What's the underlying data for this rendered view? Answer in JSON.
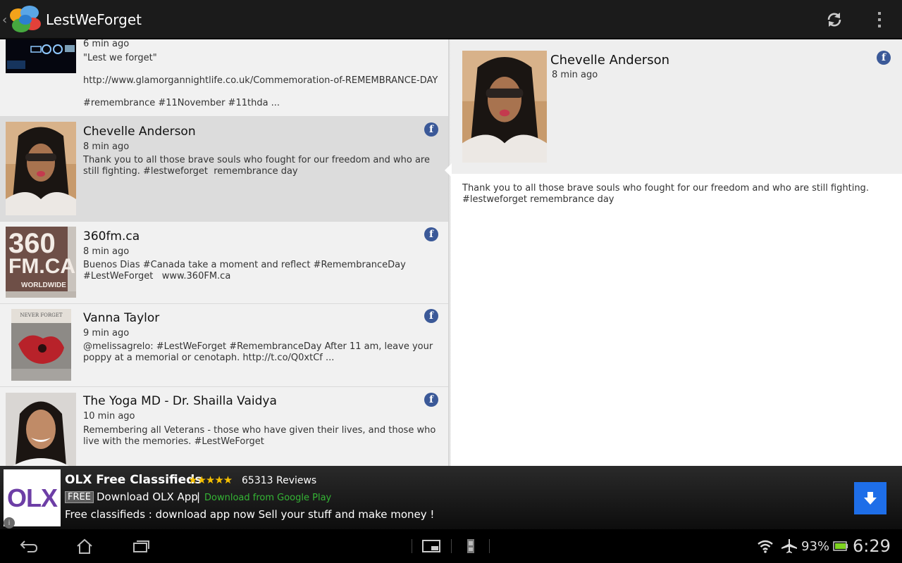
{
  "app": {
    "title": "LestWeForget",
    "icons": [
      "back-caret-icon",
      "chat-bubbles-logo-icon",
      "refresh-icon",
      "overflow-menu-icon"
    ]
  },
  "colors": {
    "actionbar_bg": "#1b1b1b",
    "list_bg": "#f1f1f1",
    "selected_bg": "#dcdcdc",
    "facebook_blue": "#3b5998",
    "ad_button_blue": "#1e6ee8",
    "star_gold": "#f6c000",
    "play_green": "#35b535"
  },
  "list": {
    "items": [
      {
        "name": "",
        "time": "6 min ago",
        "text": "\"Lest we forget\"\n\nhttp://www.glamorgannightlife.co.uk/Commemoration-of-REMEMBRANCE-DAY\n\n#remembrance #11November #11thda ...",
        "source_icon": "none"
      },
      {
        "name": "Chevelle Anderson",
        "time": "8 min ago",
        "text": "Thank you to all those brave souls who fought for our freedom and who are still fighting. #lestweforget  remembrance day",
        "source_icon": "facebook-icon",
        "selected": true
      },
      {
        "name": "360fm.ca",
        "time": "8 min ago",
        "text": "Buenos Dias #Canada take a moment and reflect #RemembranceDay #LestWeForget   www.360FM.ca",
        "source_icon": "facebook-icon",
        "thumb_text": {
          "line1": "360",
          "line2": "FM.CA",
          "line3": "WORLDWIDE"
        }
      },
      {
        "name": "Vanna Taylor",
        "time": "9 min ago",
        "text": "@melissagrelo: #LestWeForget #RemembranceDay After 11 am, leave your poppy at a memorial or cenotaph. http://t.co/Q0xtCf ...",
        "source_icon": "facebook-icon",
        "thumb_text": {
          "caption": "NEVER FORGET"
        }
      },
      {
        "name": "The Yoga MD - Dr. Shailla Vaidya",
        "time": "10 min ago",
        "text": "Remembering all Veterans - those who have given their lives, and those who live with the memories. #LestWeForget",
        "source_icon": "facebook-icon"
      }
    ]
  },
  "detail": {
    "name": "Chevelle Anderson",
    "time": "8 min ago",
    "text": "Thank you to all those brave souls who fought for our freedom and who are still fighting. #lestweforget remembrance day",
    "source_icon": "facebook-icon"
  },
  "ad": {
    "logo_text": "OLX",
    "title": "OLX Free Classifieds",
    "stars": "★★★★★",
    "rating": 4.5,
    "reviews": "65313 Reviews",
    "free_badge": "FREE",
    "download_label": "Download OLX App",
    "separator": "|",
    "play_label": "Download from Google Play",
    "description": "Free classifieds : download app now Sell your stuff and make money !",
    "info_icon": "info-icon",
    "button_icon": "download-arrow-icon"
  },
  "navbar": {
    "icons": [
      "back-nav-icon",
      "home-icon",
      "recent-apps-icon",
      "screenshot-icon",
      "sd-card-icon",
      "wifi-icon",
      "airplane-icon",
      "battery-icon"
    ],
    "battery": "93%",
    "clock": "6:29"
  }
}
